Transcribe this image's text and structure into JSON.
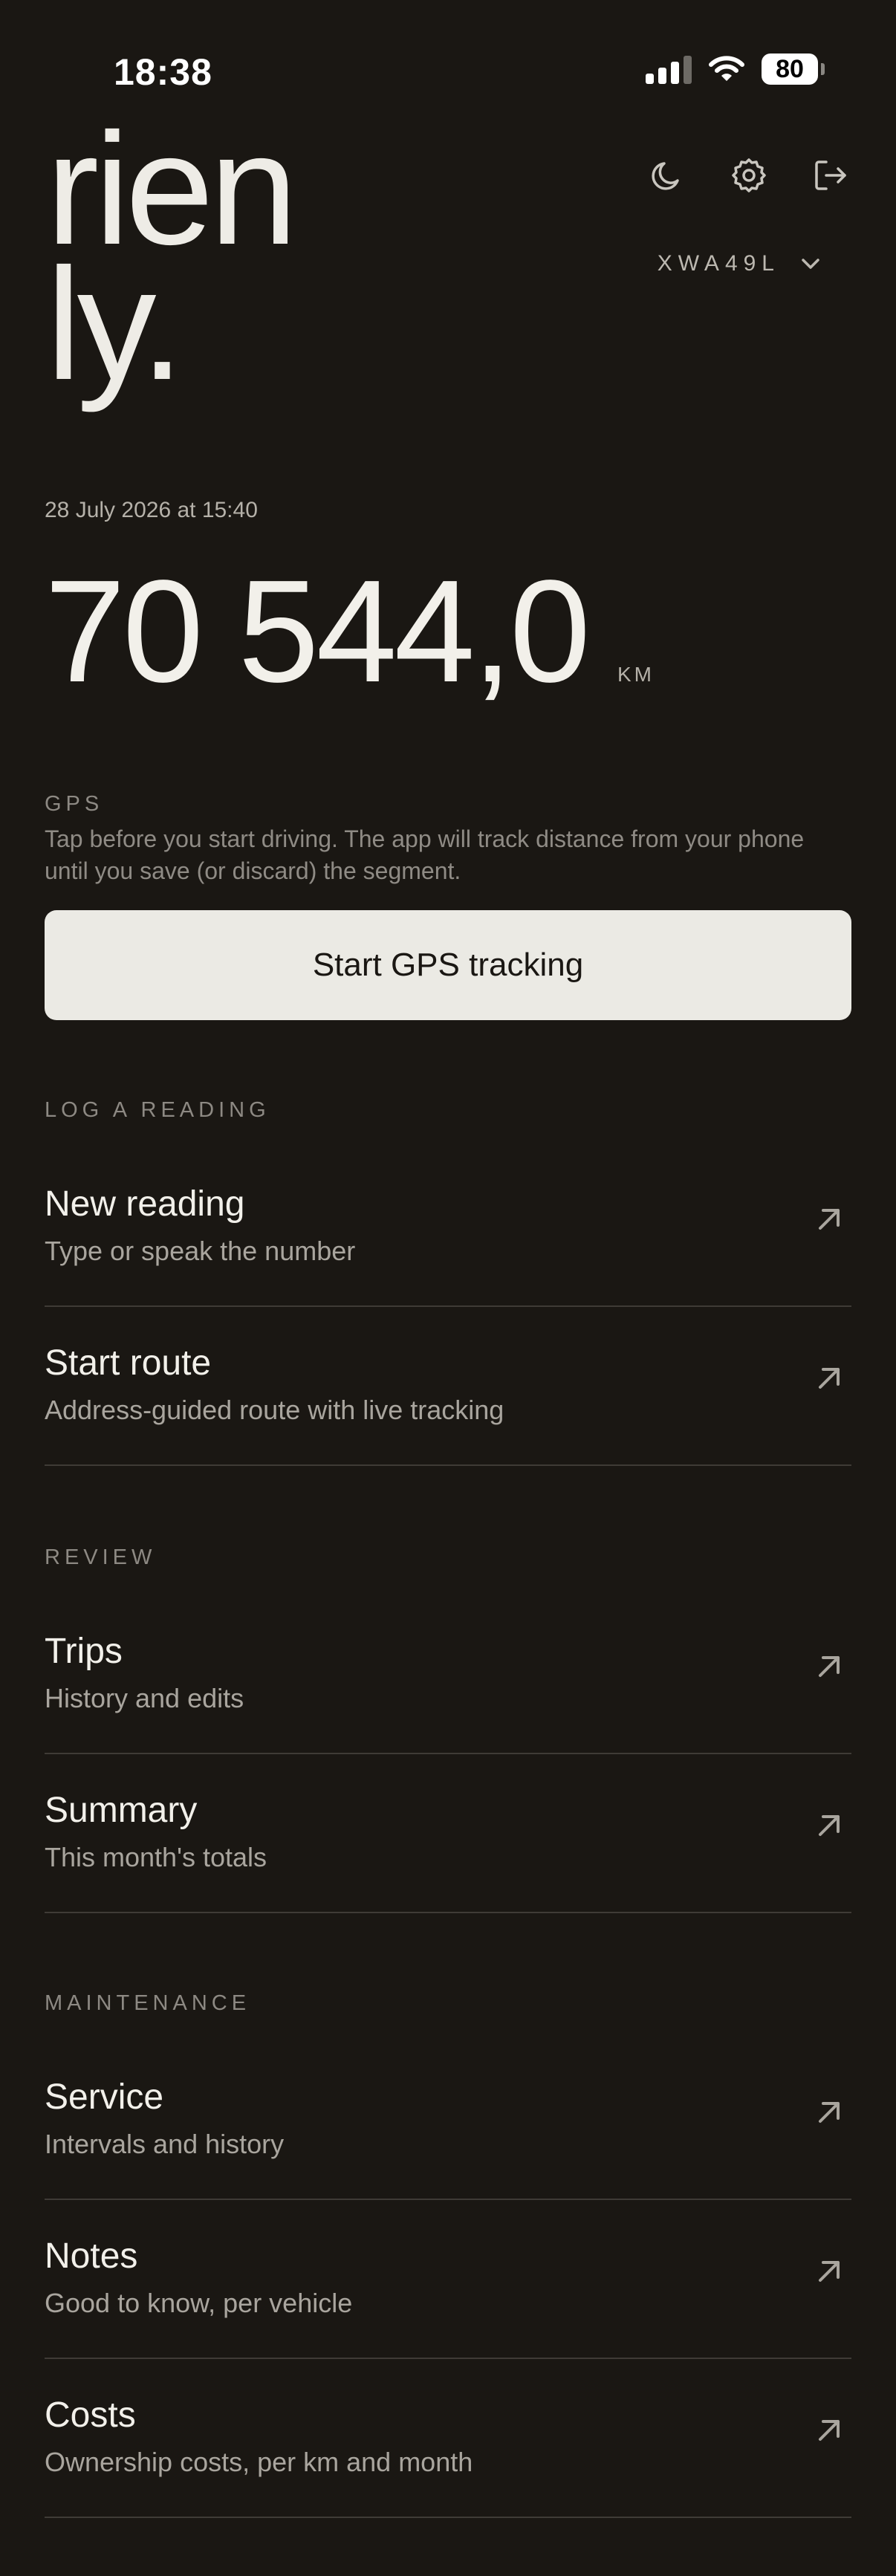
{
  "status_bar": {
    "time": "18:38",
    "battery": "80"
  },
  "brand": {
    "line1": "rien",
    "line2": "ly."
  },
  "header": {
    "icons": [
      "moon-icon",
      "gear-icon",
      "logout-icon"
    ],
    "vehicle_id": "XWA49L"
  },
  "odometer": {
    "timestamp": "28 July 2026 at 15:40",
    "value": "70 544,0",
    "unit": "KM"
  },
  "gps": {
    "label": "GPS",
    "description": "Tap before you start driving. The app will track distance from your phone until you save (or discard) the segment.",
    "button": "Start GPS tracking"
  },
  "sections": {
    "log": {
      "label": "LOG A READING",
      "items": [
        {
          "title": "New reading",
          "subtitle": "Type or speak the number"
        },
        {
          "title": "Start route",
          "subtitle": "Address-guided route with live tracking"
        }
      ]
    },
    "review": {
      "label": "REVIEW",
      "items": [
        {
          "title": "Trips",
          "subtitle": "History and edits"
        },
        {
          "title": "Summary",
          "subtitle": "This month's totals"
        }
      ]
    },
    "maintenance": {
      "label": "MAINTENANCE",
      "items": [
        {
          "title": "Service",
          "subtitle": "Intervals and history"
        },
        {
          "title": "Notes",
          "subtitle": "Good to know, per vehicle"
        },
        {
          "title": "Costs",
          "subtitle": "Ownership costs, per km and month"
        }
      ]
    }
  },
  "colors": {
    "background": "#1a1713",
    "text": "#eeece6",
    "button": "#ebeae4",
    "divider": "#3f3b36"
  }
}
